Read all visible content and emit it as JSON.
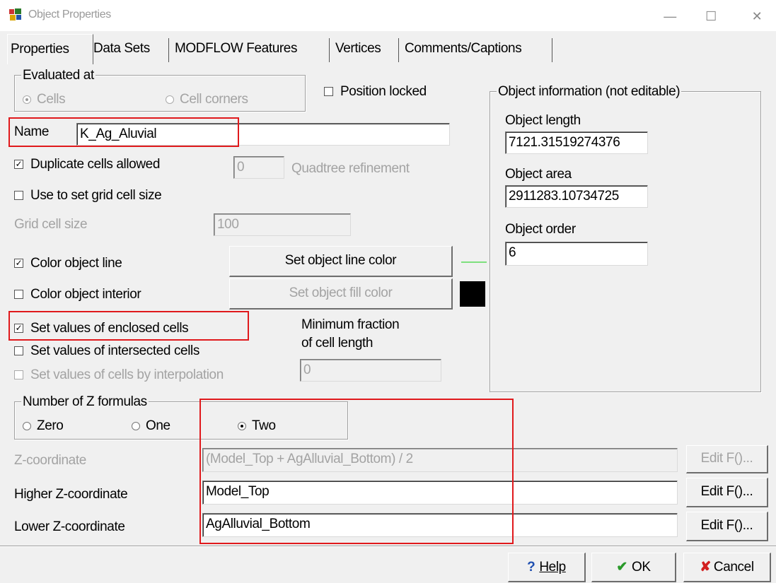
{
  "window": {
    "title": "Object Properties",
    "minimize": "—",
    "maximize": "☐",
    "close": "✕"
  },
  "tabs": [
    {
      "label": "Properties"
    },
    {
      "label": "Data Sets"
    },
    {
      "label": "MODFLOW Features"
    },
    {
      "label": "Vertices"
    },
    {
      "label": "Comments/Captions"
    }
  ],
  "evaluated": {
    "legend": "Evaluated at",
    "cells": "Cells",
    "corners": "Cell corners"
  },
  "position_locked": "Position locked",
  "name": {
    "label": "Name",
    "value": "K_Ag_Aluvial"
  },
  "duplicate": {
    "label": "Duplicate cells allowed",
    "value": "0",
    "quadtree": "Quadtree refinement"
  },
  "use_grid": {
    "label": "Use to set grid cell size"
  },
  "grid_cell": {
    "label": "Grid cell size",
    "value": "100"
  },
  "color_line": {
    "label": "Color object line",
    "button": "Set object line color",
    "swatch": "#7ee07e"
  },
  "color_interior": {
    "label": "Color object interior",
    "button": "Set object fill color",
    "swatch": "#000000"
  },
  "enclosed": {
    "label": "Set values of enclosed cells"
  },
  "intersected": {
    "label": "Set values of intersected cells"
  },
  "interpolation": {
    "label": "Set values of cells by interpolation"
  },
  "min_fraction": {
    "line1": "Minimum fraction",
    "line2": "of cell length",
    "value": "0"
  },
  "object_info": {
    "legend": "Object information (not editable)",
    "length_label": "Object length",
    "length_value": "7121.31519274376",
    "area_label": "Object area",
    "area_value": "2911283.10734725",
    "order_label": "Object order",
    "order_value": "6"
  },
  "z_formulas": {
    "legend": "Number of Z formulas",
    "zero": "Zero",
    "one": "One",
    "two": "Two"
  },
  "z_coord": {
    "label": "Z-coordinate",
    "value": "(Model_Top + AgAlluvial_Bottom) / 2",
    "button": "Edit F()..."
  },
  "higher_z": {
    "label": "Higher Z-coordinate",
    "value": "Model_Top",
    "button": "Edit F()..."
  },
  "lower_z": {
    "label": "Lower Z-coordinate",
    "value": "AgAlluvial_Bottom",
    "button": "Edit F()..."
  },
  "footer": {
    "help": "Help",
    "help_icon": "?",
    "ok": "OK",
    "ok_icon": "✔",
    "cancel": "Cancel",
    "cancel_icon": "✘"
  }
}
